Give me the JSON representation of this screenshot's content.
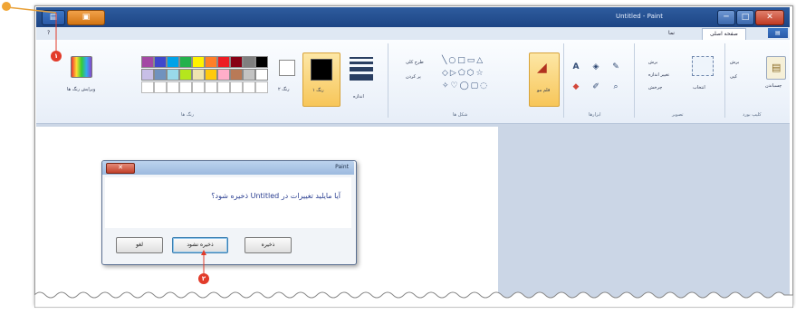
{
  "window": {
    "title": "Untitled - Paint",
    "controls": [
      "─",
      "□",
      "✕"
    ]
  },
  "ribbon": {
    "tabs": [
      "صفحه اصلی",
      "نما"
    ],
    "groups": {
      "clipboard": "کلیپ بورد",
      "image": "تصویر",
      "tools": "ابزارها",
      "shapes": "شکل ها",
      "colors": "رنگ ها"
    },
    "labels": {
      "paste": "چسباندن",
      "cut": "برش",
      "copy": "کپی",
      "select": "انتخاب",
      "crop": "برش",
      "resize": "تغییر اندازه",
      "rotate": "چرخش",
      "brushes": "قلم مو",
      "outline": "طرح کلی",
      "fill": "پر کردن",
      "size": "اندازه",
      "color1": "رنگ ۱",
      "color2": "رنگ ۲",
      "edit_colors": "ویرایش رنگ ها"
    }
  },
  "dialog": {
    "title": "Paint",
    "message": "آیا مایلید تغییرات در Untitled ذخیره شود؟",
    "buttons": {
      "save": "ذخیره",
      "dont_save": "ذخیره نشود",
      "cancel": "لغو"
    }
  },
  "callouts": [
    "۱",
    "۲"
  ],
  "colors": {
    "palette_row1": [
      "#000000",
      "#7f7f7f",
      "#880015",
      "#ed1c24",
      "#ff7f27",
      "#fff200",
      "#22b14c",
      "#00a2e8",
      "#3f48cc",
      "#a349a4"
    ],
    "palette_row2": [
      "#ffffff",
      "#c3c3c3",
      "#b97a57",
      "#ffaec9",
      "#ffc90e",
      "#efe4b0",
      "#b5e61d",
      "#99d9ea",
      "#7092be",
      "#c8bfe7"
    ],
    "accent": "#e23b2a"
  }
}
